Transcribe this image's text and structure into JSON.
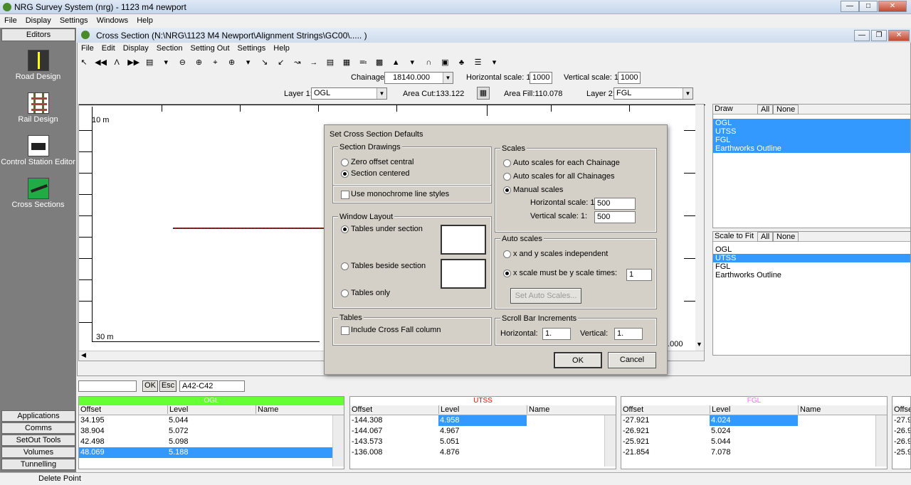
{
  "app": {
    "title": "NRG Survey System (nrg) - 1123 m4 newport"
  },
  "menu": [
    "File",
    "Display",
    "Settings",
    "Windows",
    "Help"
  ],
  "left_panel": {
    "editors": "Editors",
    "tools": [
      "Road Design",
      "Rail Design",
      "Control Station Editor",
      "Cross Sections"
    ],
    "bottom": [
      "Applications",
      "Comms",
      "SetOut Tools",
      "Volumes",
      "Tunnelling"
    ]
  },
  "cross_section": {
    "title": "Cross Section  (N:\\NRG\\1123 M4 Newport\\Alignment Strings\\GC00\\..... )",
    "menu": [
      "File",
      "Edit",
      "Display",
      "Section",
      "Setting Out",
      "Settings",
      "Help"
    ],
    "chainage_label": "Chainage",
    "chainage": "18140.000",
    "hscale_label": "Horizontal scale: 1:",
    "hscale": "1000",
    "vscale_label": "Vertical scale: 1:",
    "vscale": "1000",
    "layer1_label": "Layer 1:",
    "layer1": "OGL",
    "area_cut": "Area Cut:133.122",
    "area_fill": "Area Fill:110.078",
    "layer2_label": "Layer 2:",
    "layer2": "FGL",
    "axis_top": "10 m",
    "axis_bottom": "30 m",
    "axis_right": "2.000"
  },
  "draw_list": {
    "title": "Draw",
    "all": "All",
    "none": "None",
    "items": [
      "OGL",
      "UTSS",
      "FGL",
      "Earthworks Outline"
    ]
  },
  "scale_list": {
    "title": "Scale to Fit",
    "all": "All",
    "none": "None",
    "items": [
      "OGL",
      "UTSS",
      "FGL",
      "Earthworks Outline"
    ]
  },
  "dialog": {
    "title": "Set Cross Section Defaults",
    "section_drawings": "Section Drawings",
    "zero_offset": "Zero offset central",
    "section_centered": "Section centered",
    "monochrome": "Use monochrome line styles",
    "window_layout": "Window Layout",
    "tables_under": "Tables under section",
    "tables_beside": "Tables beside section",
    "tables_only": "Tables only",
    "tables": "Tables",
    "cross_fall": "Include Cross Fall column",
    "scales": "Scales",
    "auto_each": "Auto scales for each Chainage",
    "auto_all": "Auto scales for all Chainages",
    "manual": "Manual scales",
    "h_scale_label": "Horizontal scale:  1:",
    "h_scale": "500",
    "v_scale_label": "Vertical scale:  1:",
    "v_scale": "500",
    "auto_scales": "Auto scales",
    "xy_independent": "x and y scales independent",
    "x_times_y": "x scale must be y scale times:",
    "times_value": "1",
    "set_auto": "Set Auto Scales...",
    "scroll_incr": "Scroll Bar Increments",
    "horizontal_label": "Horizontal:",
    "horizontal": "1.",
    "vertical_label": "Vertical:",
    "vertical": "1.",
    "ok": "OK",
    "cancel": "Cancel"
  },
  "point_bar": {
    "input": "",
    "ok": "OK",
    "esc": "Esc",
    "value": "A42-C42"
  },
  "tables": [
    {
      "name": "OGL",
      "color": "#66ff33",
      "cols": [
        "Offset",
        "Level",
        "Name"
      ],
      "rows": [
        [
          "34.195",
          "5.044",
          ""
        ],
        [
          "38.904",
          "5.072",
          ""
        ],
        [
          "42.498",
          "5.098",
          ""
        ],
        [
          "48.069",
          "5.188",
          ""
        ]
      ]
    },
    {
      "name": "UTSS",
      "color": "#ff0000",
      "cols": [
        "Offset",
        "Level",
        "Name"
      ],
      "rows": [
        [
          "-144.308",
          "4.958",
          ""
        ],
        [
          "-144.067",
          "4.967",
          ""
        ],
        [
          "-143.573",
          "5.051",
          ""
        ],
        [
          "-136.008",
          "4.876",
          ""
        ]
      ]
    },
    {
      "name": "FGL",
      "color": "#ff66ff",
      "cols": [
        "Offset",
        "Level",
        "Name"
      ],
      "rows": [
        [
          "-27.921",
          "4.024",
          ""
        ],
        [
          "-26.921",
          "5.024",
          ""
        ],
        [
          "-25.921",
          "5.044",
          ""
        ],
        [
          "-21.854",
          "7.078",
          ""
        ]
      ]
    },
    {
      "cols": [
        "Offset"
      ],
      "rows": [
        [
          "-27.9"
        ],
        [
          "-26.9"
        ],
        [
          "-26.9"
        ],
        [
          "-25.9"
        ]
      ]
    }
  ],
  "status": "Delete Point"
}
